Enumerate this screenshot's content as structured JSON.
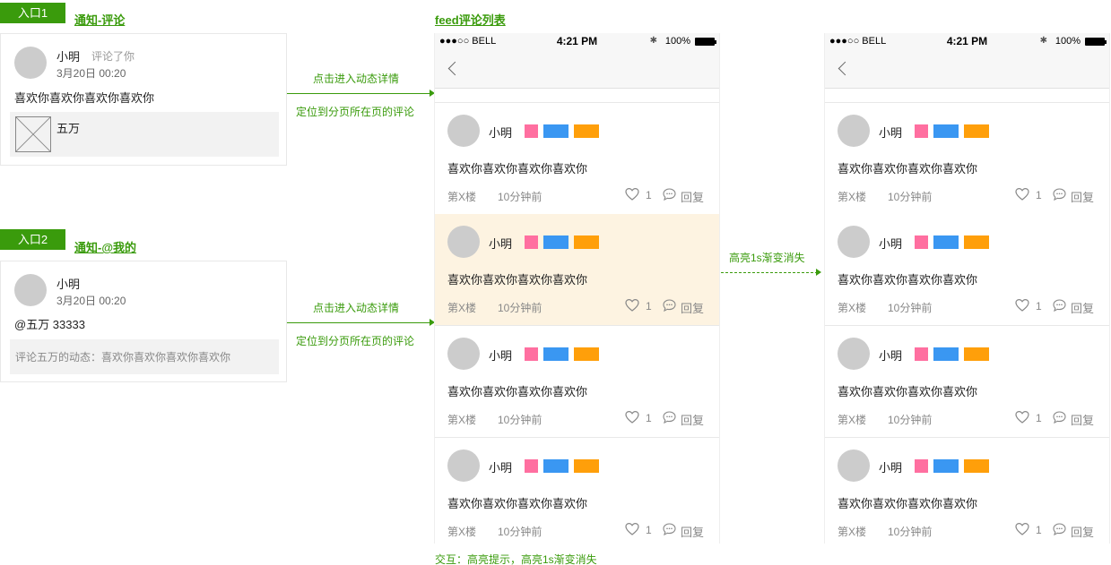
{
  "entry1": {
    "tag": "入口1",
    "title": "通知-评论",
    "name": "小明",
    "action": "评论了你",
    "time": "3月20日  00:20",
    "content": "喜欢你喜欢你喜欢你喜欢你",
    "quote_label": "五万"
  },
  "entry2": {
    "tag": "入口2",
    "title": "通知-@我的",
    "name": "小明",
    "time": "3月20日  00:20",
    "content": "@五万 33333",
    "quote_text": "评论五万的动态：喜欢你喜欢你喜欢你喜欢你"
  },
  "arrow1": {
    "top": "点击进入动态详情",
    "bottom": "定位到分页所在页的评论"
  },
  "arrow2": {
    "top": "点击进入动态详情",
    "bottom": "定位到分页所在页的评论"
  },
  "arrow3": {
    "label": "高亮1s渐变消失"
  },
  "section_title": "feed评论列表",
  "footnote": "交互：高亮提示，高亮1s渐变消失",
  "statusbar": {
    "carrier": "●●●○○ BELL",
    "time": "4:21 PM",
    "battery": "100%"
  },
  "badge_colors": [
    "#ff6fa0",
    "#3a97f2",
    "#ff9f0a"
  ],
  "highlight_color": "#fdf3e1",
  "comment": {
    "name": "小明",
    "text": "喜欢你喜欢你喜欢你喜欢你",
    "floor": "第X楼",
    "time": "10分钟前",
    "likes": "1",
    "reply": "回复"
  }
}
